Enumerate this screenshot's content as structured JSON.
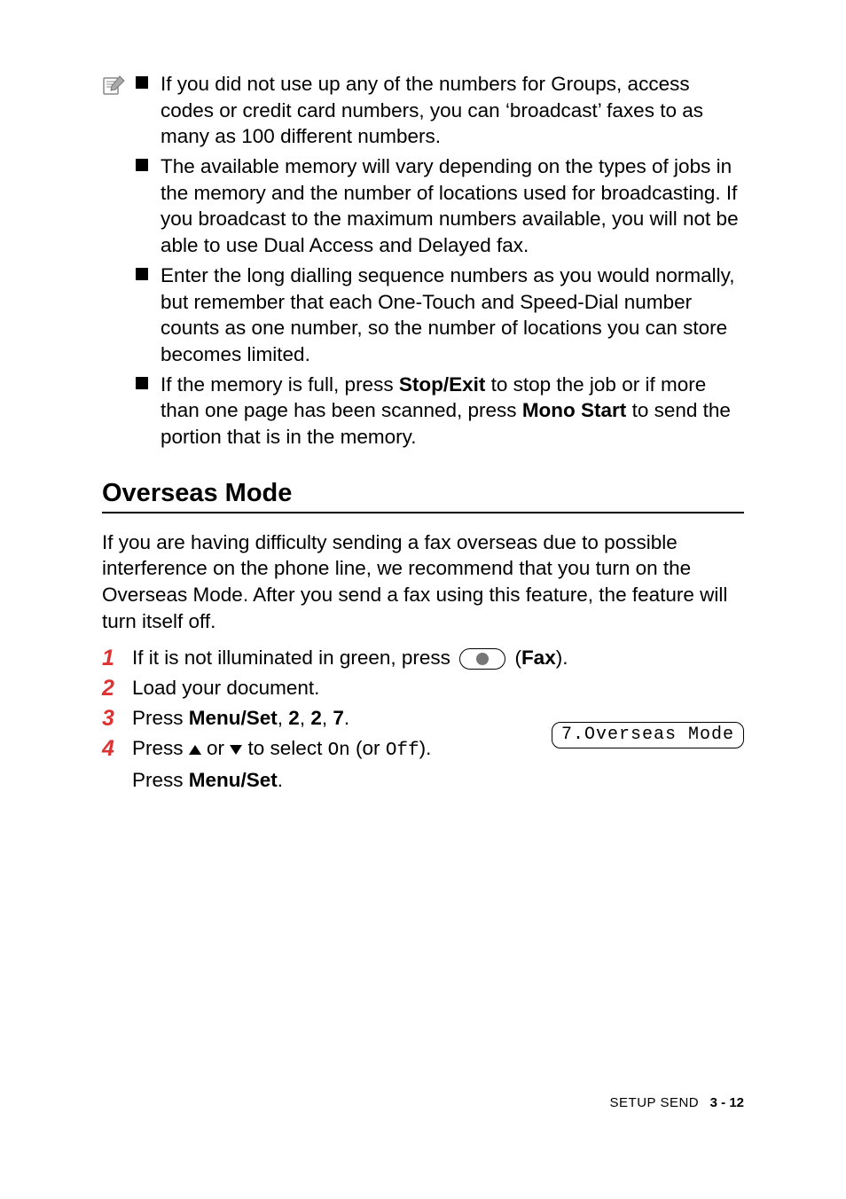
{
  "note": {
    "items": [
      "If you did not use up any of the numbers for Groups, access codes or credit card numbers, you can ‘broadcast’ faxes to as many as 100 different numbers.",
      "The available memory will vary depending on the types of jobs in the memory and the number of locations used for broadcasting. If you broadcast to the maximum numbers available, you will not be able to use Dual Access and Delayed fax.",
      "Enter the long dialling sequence numbers as you would normally, but remember that each One-Touch and Speed-Dial number counts as one number, so the number of locations you can store becomes limited."
    ],
    "item4_pre": "If the memory is full, press ",
    "item4_bold1": "Stop/Exit",
    "item4_mid": " to stop the job or if more than one page has been scanned, press ",
    "item4_bold2": "Mono Start",
    "item4_post": " to send the portion that is in the memory."
  },
  "heading": "Overseas Mode",
  "intro": "If you are having difficulty sending a fax overseas due to possible interference on the phone line, we recommend that you turn on the Overseas Mode. After you send a fax using this feature, the feature will turn itself off.",
  "steps": {
    "n1": "1",
    "s1_pre": "If it is not illuminated in green, press ",
    "s1_paren_open": " (",
    "s1_fax": "Fax",
    "s1_paren_close": ").",
    "n2": "2",
    "s2": "Load your document.",
    "n3": "3",
    "s3_pre": "Press ",
    "s3_b1": "Menu/Set",
    "s3_c1": ", ",
    "s3_b2": "2",
    "s3_c2": ", ",
    "s3_b3": "2",
    "s3_c3": ", ",
    "s3_b4": "7",
    "s3_post": ".",
    "n4": "4",
    "s4_pre": "Press ",
    "s4_or": " or ",
    "s4_mid": " to select ",
    "s4_on": "On",
    "s4_paren": " (or ",
    "s4_off": "Off",
    "s4_post": ").",
    "s4_sub_pre": "Press ",
    "s4_sub_bold": "Menu/Set",
    "s4_sub_post": "."
  },
  "lcd": "7.Overseas Mode",
  "footer": {
    "label": "SETUP SEND",
    "page": "3 - 12"
  }
}
